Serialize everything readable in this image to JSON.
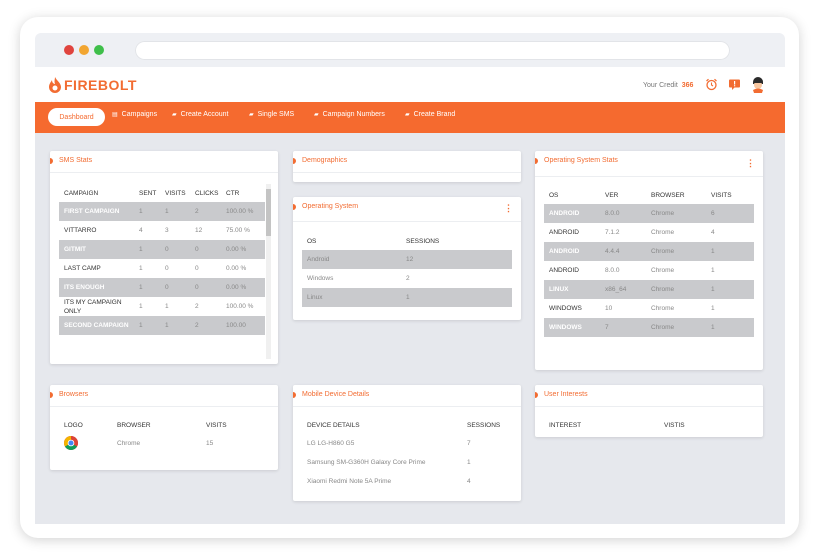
{
  "logo": {
    "text": "FIREBOLT"
  },
  "header": {
    "credit_label": "Your Credit",
    "credit_value": "366"
  },
  "nav": {
    "active": "Dashboard",
    "items": [
      "Campaigns",
      "Create Account",
      "Single SMS",
      "Campaign Numbers",
      "Create Brand"
    ]
  },
  "sms_stats": {
    "title": "SMS Stats",
    "columns": [
      "CAMPAIGN",
      "SENT",
      "VISITS",
      "CLICKS",
      "CTR"
    ],
    "rows": [
      {
        "campaign": "FIRST CAMPAIGN",
        "sent": "1",
        "visits": "1",
        "clicks": "2",
        "ctr": "100.00 %",
        "shade": true
      },
      {
        "campaign": "VITTARRO",
        "sent": "4",
        "visits": "3",
        "clicks": "12",
        "ctr": "75.00 %",
        "shade": false
      },
      {
        "campaign": "GITMIT",
        "sent": "1",
        "visits": "0",
        "clicks": "0",
        "ctr": "0.00 %",
        "shade": true
      },
      {
        "campaign": "LAST CAMP",
        "sent": "1",
        "visits": "0",
        "clicks": "0",
        "ctr": "0.00 %",
        "shade": false
      },
      {
        "campaign": "ITS ENOUGH",
        "sent": "1",
        "visits": "0",
        "clicks": "0",
        "ctr": "0.00 %",
        "shade": true
      },
      {
        "campaign": "ITS MY CAMPAIGN ONLY",
        "sent": "1",
        "visits": "1",
        "clicks": "2",
        "ctr": "100.00 %",
        "shade": false
      },
      {
        "campaign": "SECOND CAMPAIGN",
        "sent": "1",
        "visits": "1",
        "clicks": "2",
        "ctr": "100.00",
        "shade": true
      }
    ]
  },
  "demographics": {
    "title": "Demographics"
  },
  "operating_system": {
    "title": "Operating System",
    "columns": [
      "OS",
      "SESSIONS"
    ],
    "rows": [
      {
        "os": "Android",
        "sessions": "12",
        "shade": true
      },
      {
        "os": "Windows",
        "sessions": "2",
        "shade": false
      },
      {
        "os": "Linux",
        "sessions": "1",
        "shade": true
      }
    ]
  },
  "os_stats": {
    "title": "Operating System Stats",
    "columns": [
      "OS",
      "VER",
      "BROWSER",
      "VISITS"
    ],
    "rows": [
      {
        "os": "ANDROID",
        "ver": "8.0.0",
        "browser": "Chrome",
        "visits": "6",
        "shade": true
      },
      {
        "os": "ANDROID",
        "ver": "7.1.2",
        "browser": "Chrome",
        "visits": "4",
        "shade": false
      },
      {
        "os": "ANDROID",
        "ver": "4.4.4",
        "browser": "Chrome",
        "visits": "1",
        "shade": true
      },
      {
        "os": "ANDROID",
        "ver": "8.0.0",
        "browser": "Chrome",
        "visits": "1",
        "shade": false
      },
      {
        "os": "LINUX",
        "ver": "x86_64",
        "browser": "Chrome",
        "visits": "1",
        "shade": true
      },
      {
        "os": "WINDOWS",
        "ver": "10",
        "browser": "Chrome",
        "visits": "1",
        "shade": false
      },
      {
        "os": "WINDOWS",
        "ver": "7",
        "browser": "Chrome",
        "visits": "1",
        "shade": true
      }
    ]
  },
  "browsers": {
    "title": "Browsers",
    "columns": [
      "LOGO",
      "BROWSER",
      "VISITS"
    ],
    "rows": [
      {
        "browser": "Chrome",
        "visits": "15",
        "logo": "chrome-logo"
      }
    ]
  },
  "mobile": {
    "title": "Mobile Device Details",
    "columns": [
      "DEVICE DETAILS",
      "SESSIONS"
    ],
    "rows": [
      {
        "device": "LG LG-H860 G5",
        "sessions": "7"
      },
      {
        "device": "Samsung SM-G360H Galaxy Core Prime",
        "sessions": "1"
      },
      {
        "device": "Xiaomi Redmi Note 5A Prime",
        "sessions": "4"
      }
    ]
  },
  "interests": {
    "title": "User Interests",
    "columns": [
      "INTEREST",
      "VISTIS"
    ]
  },
  "colors": {
    "accent": "#f56a2f",
    "shade": "#c9cacd",
    "background": "#e6e8ed"
  }
}
